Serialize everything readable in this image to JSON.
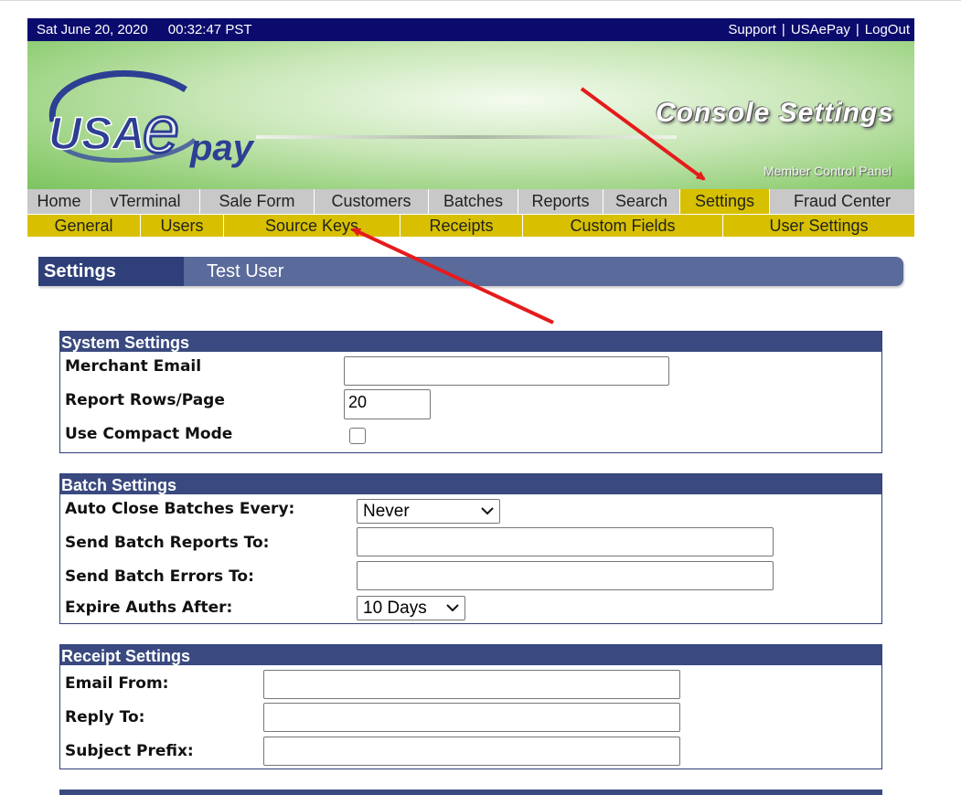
{
  "topbar": {
    "date": "Sat June 20, 2020",
    "time": "00:32:47 PST",
    "links": [
      "Support",
      "USAePay",
      "LogOut"
    ]
  },
  "banner": {
    "logo_text_usa": "USA",
    "logo_text_e": "e",
    "logo_text_pay": "pay",
    "title": "Console Settings",
    "subtitle": "Member Control Panel"
  },
  "nav_main": [
    "Home",
    "vTerminal",
    "Sale Form",
    "Customers",
    "Batches",
    "Reports",
    "Search",
    "Settings",
    "Fraud Center"
  ],
  "nav_main_active": "Settings",
  "nav_sub": [
    "General",
    "Users",
    "Source Keys",
    "Receipts",
    "Custom Fields",
    "User Settings"
  ],
  "page_title": {
    "section": "Settings",
    "user": "Test User"
  },
  "system_settings": {
    "header": "System Settings",
    "merchant_email_label": "Merchant Email",
    "merchant_email_value": "",
    "report_rows_label": "Report Rows/Page",
    "report_rows_value": "20",
    "compact_mode_label": "Use Compact Mode",
    "compact_mode_checked": false
  },
  "batch_settings": {
    "header": "Batch Settings",
    "auto_close_label": "Auto Close Batches Every:",
    "auto_close_value": "Never",
    "send_reports_label": "Send Batch Reports To:",
    "send_reports_value": "",
    "send_errors_label": "Send Batch Errors To:",
    "send_errors_value": "",
    "expire_auths_label": "Expire Auths After:",
    "expire_auths_value": "10 Days"
  },
  "receipt_settings": {
    "header": "Receipt Settings",
    "email_from_label": "Email From:",
    "email_from_value": "",
    "reply_to_label": "Reply To:",
    "reply_to_value": "",
    "subject_prefix_label": "Subject Prefix:",
    "subject_prefix_value": ""
  },
  "colors": {
    "topbar": "#0b0b6e",
    "nav_main": "#c8c8c8",
    "nav_active": "#d7c000",
    "nav_sub": "#d8c000",
    "section_header": "#3a4a80",
    "annotation_arrow": "#e51b1b"
  }
}
